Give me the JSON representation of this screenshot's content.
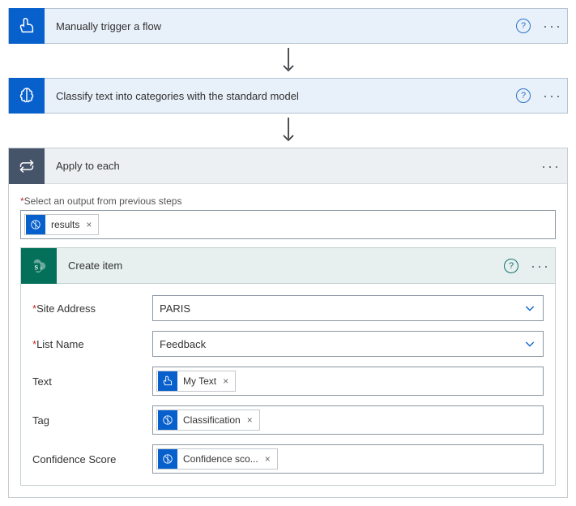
{
  "nodes": {
    "trigger": {
      "title": "Manually trigger a flow"
    },
    "classify": {
      "title": "Classify text into categories with the standard model"
    }
  },
  "container": {
    "title": "Apply to each",
    "output_label_prefix": "*",
    "output_label": "Select an output from previous steps",
    "output_token": "results"
  },
  "createItem": {
    "title": "Create item",
    "fields": {
      "siteAddress": {
        "label": "Site Address",
        "value": "PARIS",
        "required": true
      },
      "listName": {
        "label": "List Name",
        "value": "Feedback",
        "required": true
      },
      "text": {
        "label": "Text",
        "token": "My Text"
      },
      "tag": {
        "label": "Tag",
        "token": "Classification"
      },
      "confidence": {
        "label": "Confidence Score",
        "token": "Confidence sco..."
      }
    }
  }
}
